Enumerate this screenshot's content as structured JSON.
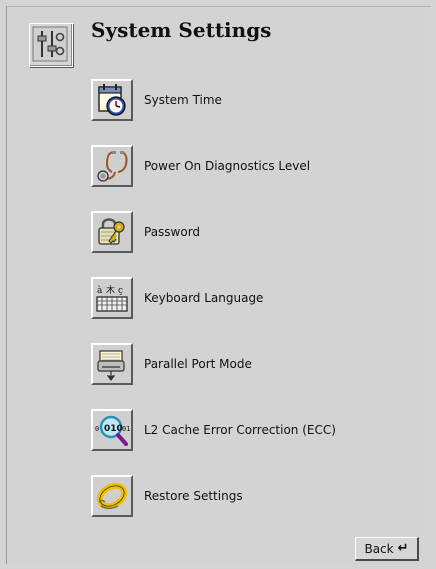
{
  "page": {
    "title": "System Settings"
  },
  "menu": [
    {
      "label": "System Time",
      "icon": "calendar-clock-icon"
    },
    {
      "label": "Power On Diagnostics Level",
      "icon": "stethoscope-icon"
    },
    {
      "label": "Password",
      "icon": "padlock-key-icon"
    },
    {
      "label": "Keyboard Language",
      "icon": "keyboard-icon"
    },
    {
      "label": "Parallel Port Mode",
      "icon": "printer-port-icon"
    },
    {
      "label": "L2 Cache Error Correction (ECC)",
      "icon": "binary-magnifier-icon"
    },
    {
      "label": "Restore Settings",
      "icon": "life-preserver-icon"
    }
  ],
  "footer": {
    "back_label": "Back",
    "back_glyph": "↵"
  },
  "colors": {
    "background": "#d4d4d4",
    "text": "#111111"
  }
}
